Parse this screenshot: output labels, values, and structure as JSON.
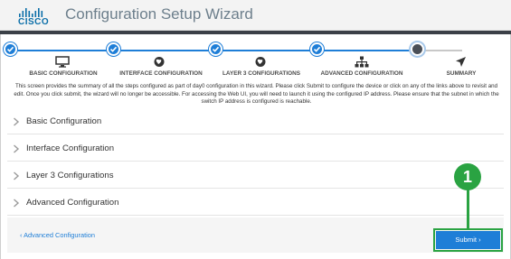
{
  "header": {
    "logo_text": "CISCO",
    "title": "Configuration Setup Wizard"
  },
  "stepper": {
    "steps": [
      {
        "label": "BASIC CONFIGURATION",
        "state": "complete",
        "icon": "monitor-icon"
      },
      {
        "label": "INTERFACE CONFIGURATION",
        "state": "complete",
        "icon": "globe-icon"
      },
      {
        "label": "LAYER 3 CONFIGURATIONS",
        "state": "complete",
        "icon": "globe-icon"
      },
      {
        "label": "ADVANCED CONFIGURATION",
        "state": "complete",
        "icon": "network-icon"
      },
      {
        "label": "SUMMARY",
        "state": "current",
        "icon": "send-icon"
      }
    ]
  },
  "description": "This screen provides the summary of all the steps configured as part of day0 configuration in this wizard. Please click Submit to configure the device or click on any of the links above to revisit and edit. Once you click submit, the wizard will no longer be accessible. For accessing the Web UI, you will need to launch it using the configured IP address. Please ensure that the subnet in which the switch IP address is configured is reachable.",
  "sections": [
    {
      "label": "Basic Configuration"
    },
    {
      "label": "Interface Configuration"
    },
    {
      "label": "Layer 3 Configurations"
    },
    {
      "label": "Advanced Configuration"
    }
  ],
  "footer": {
    "back_label": "‹ Advanced Configuration",
    "submit_label": "Submit ›"
  },
  "callout": {
    "number": "1"
  },
  "colors": {
    "accent": "#1e7ed7",
    "callout": "#2aa342",
    "title": "#6d7f8c"
  }
}
